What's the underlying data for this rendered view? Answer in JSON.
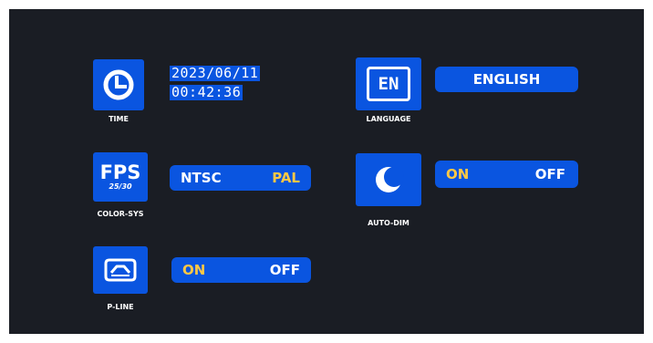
{
  "colors": {
    "background": "#1a1d24",
    "accent": "#0a55e0",
    "selected_text": "#ffc845",
    "text": "#ffffff"
  },
  "menu": {
    "time": {
      "caption": "TIME",
      "icon": "clock-icon",
      "date": "2023/06/11",
      "clock": "00:42:36"
    },
    "language": {
      "caption": "LANGUAGE",
      "icon_text": "EN",
      "value": "ENGLISH"
    },
    "color_sys": {
      "caption": "COLOR-SYS",
      "icon_title": "FPS",
      "icon_sub": "25/30",
      "option_left": "NTSC",
      "option_right": "PAL",
      "selected": "PAL"
    },
    "auto_dim": {
      "caption": "AUTO-DIM",
      "icon": "moon-icon",
      "option_on": "ON",
      "option_off": "OFF",
      "selected": "ON"
    },
    "p_line": {
      "caption": "P-LINE",
      "icon": "parking-line-icon",
      "option_on": "ON",
      "option_off": "OFF",
      "selected": "ON"
    }
  }
}
